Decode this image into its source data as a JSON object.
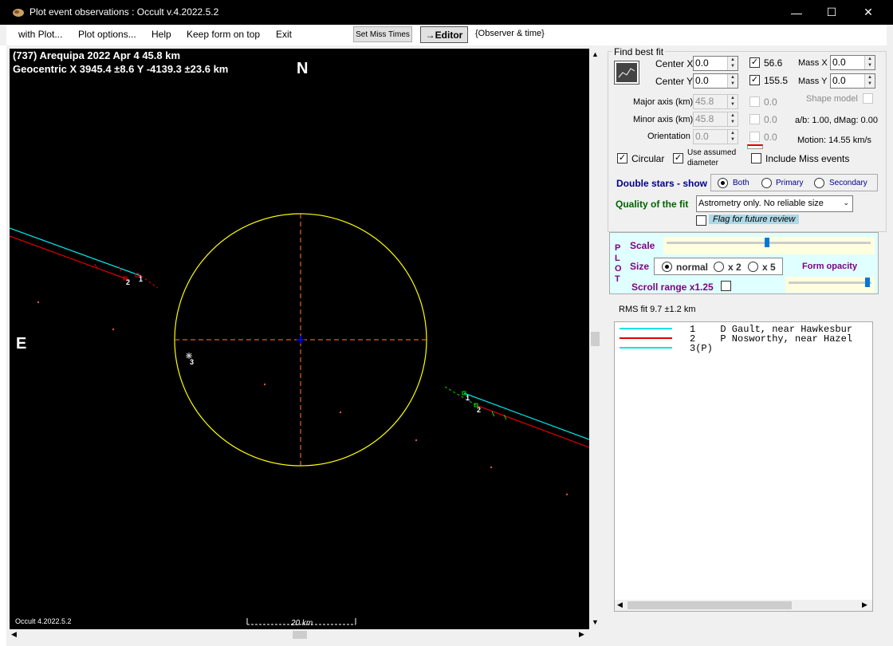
{
  "window": {
    "title": "Plot event observations : Occult v.4.2022.5.2"
  },
  "menu": {
    "items": [
      "with Plot...",
      "Plot options...",
      "Help",
      "Keep form on top",
      "Exit"
    ],
    "set_miss_times": "Set Miss Times",
    "editor": "→Editor",
    "observer_time": "{Observer & time}"
  },
  "plot": {
    "title_line1": "(737) Arequipa  2022 Apr 4   45.8 km",
    "title_line2": "Geocentric  X  3945.4 ±8.6  Y -4139.3 ±23.6 km",
    "north": "N",
    "east": "E",
    "version": "Occult 4.2022.5.2",
    "scale_bar": "20 km",
    "chord_labels": [
      "1",
      "2",
      "1",
      "2",
      "3"
    ],
    "colors": {
      "ellipse": "#ffff00",
      "chord_cyan": "#00e5e5",
      "chord_red": "#e00000",
      "center": "#0000ff"
    }
  },
  "panel": {
    "find_best_fit": "Find best fit",
    "center_x_label": "Center X",
    "center_x": "0.0",
    "center_y_label": "Center Y",
    "center_y": "0.0",
    "chk_a": "56.6",
    "chk_b": "155.5",
    "mass_x_label": "Mass X",
    "mass_x": "0.0",
    "mass_y_label": "Mass Y",
    "mass_y": "0.0",
    "major_label": "Major axis (km)",
    "major": "45.8",
    "major_chk": "0.0",
    "minor_label": "Minor axis (km)",
    "minor": "45.8",
    "minor_chk": "0.0",
    "orient_label": "Orientation",
    "orient": "0.0",
    "orient_chk": "0.0",
    "shape_model": "Shape model",
    "ab_dmag": "a/b: 1.00, dMag: 0.00",
    "motion": "Motion: 14.55 km/s",
    "circular": "Circular",
    "use_assumed": "Use assumed",
    "diameter": "diameter",
    "include_miss": "Include Miss events",
    "double_stars": "Double stars - show",
    "both": "Both",
    "primary": "Primary",
    "secondary": "Secondary",
    "quality_label": "Quality of the fit",
    "quality_value": "Astrometry only. No reliable size",
    "flag_review": "Flag for future review",
    "plot_vertical": [
      "P",
      "L",
      "O",
      "T"
    ],
    "scale_label": "Scale",
    "size_label": "Size",
    "size_normal": "normal",
    "size_x2": "x 2",
    "size_x5": "x 5",
    "form_opacity": "Form opacity",
    "scroll_range": "Scroll range x1.25",
    "rms_fit": "RMS fit 9.7 ±1.2 km"
  },
  "legend": [
    {
      "num": "1",
      "text": "  D Gault, near Hawkesbur",
      "color": "#00e5e5"
    },
    {
      "num": "2",
      "text": "  P Nosworthy, near Hazel",
      "color": "#e00000"
    },
    {
      "num": "3(P)",
      "text": "",
      "color": "#00e5e5"
    }
  ]
}
